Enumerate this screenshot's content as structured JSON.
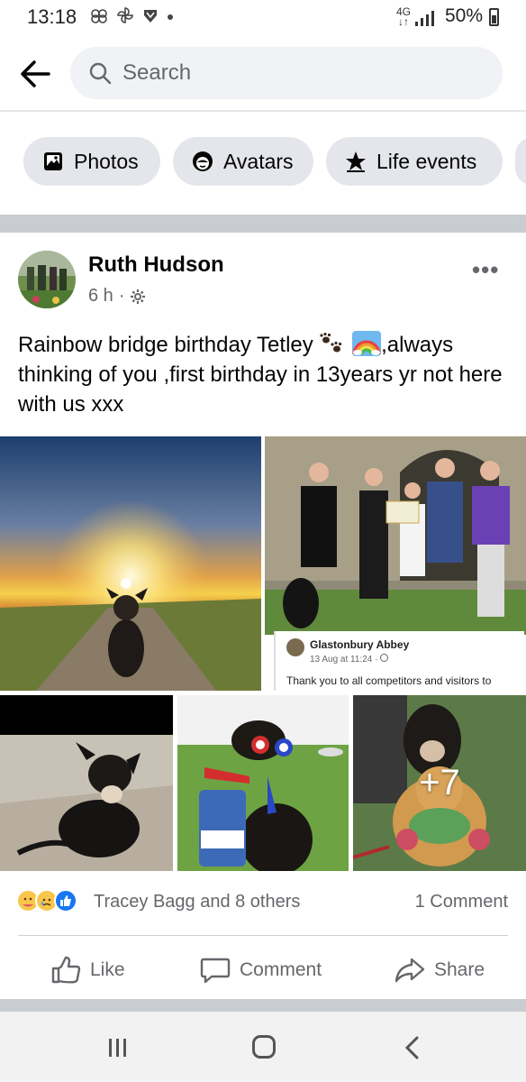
{
  "status_bar": {
    "time": "13:18",
    "network": "4G",
    "battery": "50%",
    "icons": [
      "flower-icon",
      "pinwheel-icon",
      "shield-icon",
      "dot"
    ]
  },
  "search": {
    "placeholder": "Search"
  },
  "chips": [
    {
      "label": "Photos",
      "icon": "photos-icon"
    },
    {
      "label": "Avatars",
      "icon": "avatar-icon"
    },
    {
      "label": "Life events",
      "icon": "star-icon"
    }
  ],
  "post": {
    "author": "Ruth Hudson",
    "time": "6 h",
    "text_part1": "Rainbow bridge birthday Tetley ",
    "text_part2": ",always thinking of you ,first birthday in 13years yr not here with us  xxx",
    "extra_photos": "+7",
    "shared_card": {
      "name": "Glastonbury Abbey",
      "date": "13 Aug at 11:24 · ",
      "text": "Thank you to all competitors and visitors to"
    },
    "reactions_text": "Tracey Bagg and 8 others",
    "comments_text": "1 Comment"
  },
  "actions": {
    "like": "Like",
    "comment": "Comment",
    "share": "Share"
  },
  "colors": {
    "brand_blue": "#1877f2",
    "secondary_text": "#65676b",
    "chip_bg": "#e4e6eb"
  }
}
